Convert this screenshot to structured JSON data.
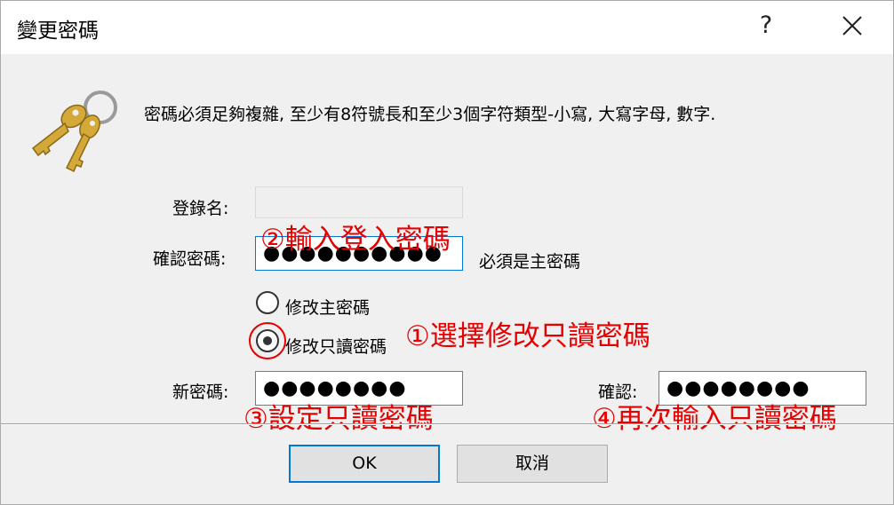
{
  "window": {
    "title": "變更密碼",
    "help": "?"
  },
  "description": "密碼必須足夠複雜, 至少有8符號長和至少3個字符類型-小寫, 大寫字母, 數字.",
  "form": {
    "login_label": "登錄名:",
    "confirm_label": "確認密碼:",
    "confirm_value": "●●●●●●●●●●",
    "confirm_hint": "必須是主密碼",
    "radio_main": "修改主密碼",
    "radio_readonly": "修改只讀密碼",
    "selected_option": "修改只讀密碼",
    "new_label": "新密碼:",
    "new_value": "●●●●●●●●",
    "confirm2_label": "確認:",
    "confirm2_value": "●●●●●●●●"
  },
  "annotations": {
    "step1": "①選擇修改只讀密碼",
    "step2": "②輸入登入密碼",
    "step3": "③設定只讀密碼",
    "step4": "④再次輸入只讀密碼"
  },
  "buttons": {
    "ok": "OK",
    "cancel": "取消"
  },
  "colors": {
    "annotation": "#e60000",
    "focus": "#0078d7",
    "key": "#d4a93a"
  }
}
